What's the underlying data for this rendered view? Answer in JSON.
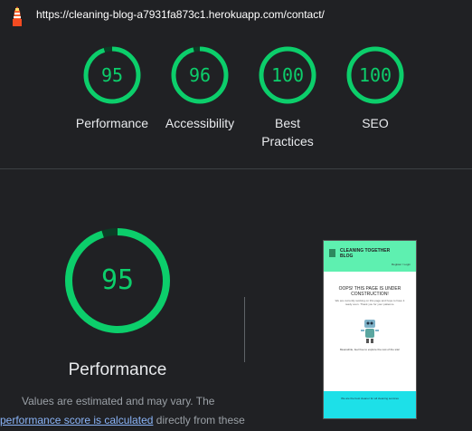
{
  "browser": {
    "url": "https://cleaning-blog-a7931fa873c1.herokuapp.com/contact/"
  },
  "colors": {
    "pass": "#0cce6b",
    "pass_track": "#0b3d25",
    "background": "#202124",
    "link": "#8ab4f8"
  },
  "scores": [
    {
      "label": "Performance",
      "value": "95",
      "fraction": 0.95
    },
    {
      "label": "Accessibility",
      "value": "96",
      "fraction": 0.96
    },
    {
      "label": "Best Practices",
      "value": "100",
      "fraction": 1.0
    },
    {
      "label": "SEO",
      "value": "100",
      "fraction": 1.0
    }
  ],
  "main": {
    "score": "95",
    "fraction": 0.95,
    "title": "Performance",
    "desc_line1": "Values are estimated and may vary. The",
    "desc_link": "performance score is calculated",
    "desc_line2_rest": "directly from these"
  },
  "thumbnail": {
    "site_title": "CLEANING TOGETHER BLOG",
    "register_login": "Register / Login",
    "heading": "OOPS! THIS PAGE IS UNDER CONSTRUCTION!",
    "body": "We are currently working on this page and hope to have it ready soon. Thank you for your patience.",
    "meanwhile": "Meanwhile, feel free to explore the rest of the site!",
    "footer": "We are the best cleaner for all cleaning services"
  }
}
